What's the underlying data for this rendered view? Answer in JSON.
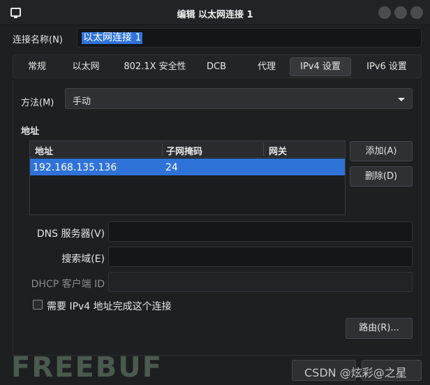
{
  "window": {
    "title": "编辑 以太网连接 1",
    "icons": {
      "app": "network-icon",
      "minimize": "minimize-icon",
      "maximize": "maximize-icon",
      "close": "close-icon"
    }
  },
  "connection": {
    "label": "连接名称(N)",
    "value": "以太网连接 1"
  },
  "tabs": [
    {
      "label": "常规"
    },
    {
      "label": "以太网"
    },
    {
      "label": "802.1X 安全性"
    },
    {
      "label": "DCB"
    },
    {
      "label": "代理"
    },
    {
      "label": "IPv4 设置",
      "active": true
    },
    {
      "label": "IPv6 设置"
    }
  ],
  "method": {
    "label": "方法(M)",
    "value": "手动"
  },
  "addresses": {
    "heading": "地址",
    "columns": [
      "地址",
      "子网掩码",
      "网关"
    ],
    "rows": [
      {
        "address": "192.168.135.136",
        "netmask": "24",
        "gateway": ""
      }
    ],
    "add_label": "添加(A)",
    "delete_label": "删除(D)"
  },
  "dns": {
    "label": "DNS 服务器(V)",
    "value": ""
  },
  "search_domains": {
    "label": "搜索域(E)",
    "value": ""
  },
  "dhcp_client_id": {
    "label": "DHCP 客户端 ID",
    "value": ""
  },
  "require_ipv4": {
    "label": "需要 IPv4 地址完成这个连接",
    "checked": false
  },
  "routes_button": "路由(R)...",
  "watermarks": {
    "left": "FREEBUF",
    "right": "CSDN @炫彩@之星"
  },
  "colors": {
    "accent": "#2f73d9",
    "background": "#1e1f21"
  }
}
